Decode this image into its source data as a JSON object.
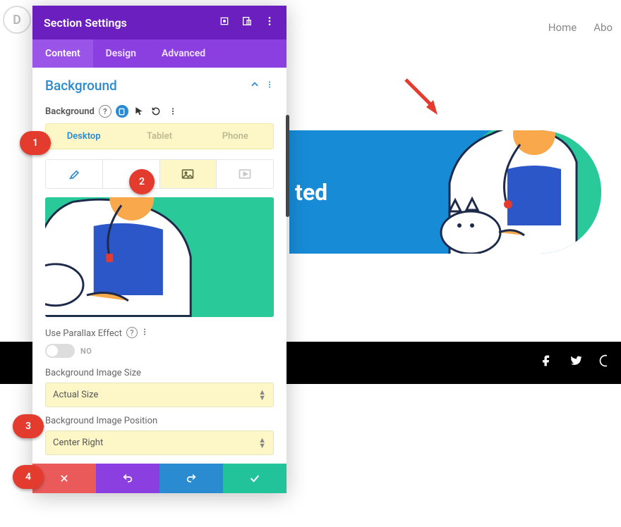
{
  "nav": {
    "items": [
      "Home",
      "Abo"
    ]
  },
  "logo": "D",
  "hero": {
    "text": "ted"
  },
  "panel": {
    "title": "Section Settings",
    "tabs": {
      "content": "Content",
      "design": "Design",
      "advanced": "Advanced"
    },
    "section": "Background",
    "bg_label": "Background",
    "devices": {
      "desktop": "Desktop",
      "tablet": "Tablet",
      "phone": "Phone"
    },
    "parallax": {
      "label": "Use Parallax Effect",
      "value": "NO"
    },
    "size": {
      "label": "Background Image Size",
      "value": "Actual Size"
    },
    "position": {
      "label": "Background Image Position",
      "value": "Center Right"
    }
  },
  "steps": {
    "s1": "1",
    "s2": "2",
    "s3": "3",
    "s4": "4"
  }
}
